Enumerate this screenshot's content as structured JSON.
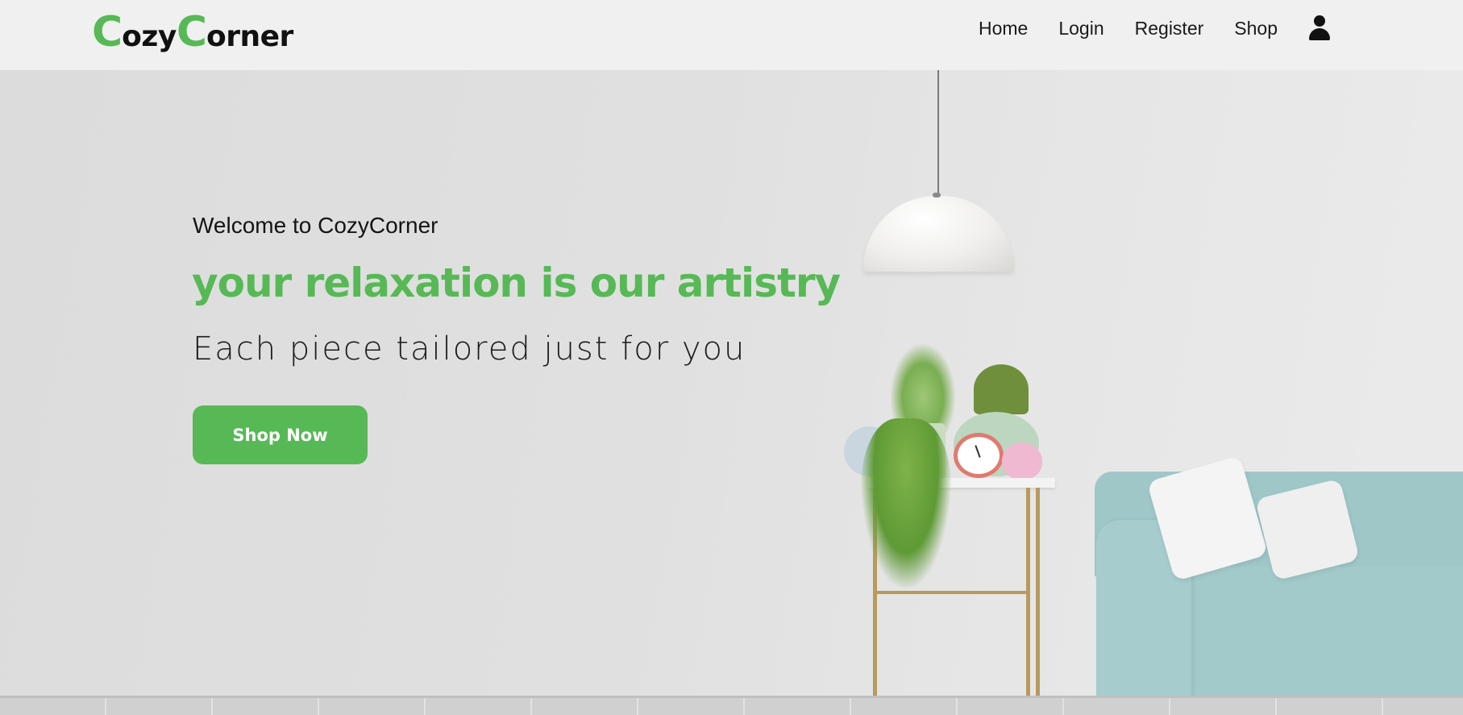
{
  "brand": {
    "first_cap": "C",
    "first_rest": "ozy",
    "second_cap": "C",
    "second_rest": "orner"
  },
  "nav": {
    "items": [
      {
        "label": "Home"
      },
      {
        "label": "Login"
      },
      {
        "label": "Register"
      },
      {
        "label": "Shop"
      }
    ],
    "user_icon": "user-icon"
  },
  "hero": {
    "welcome": "Welcome to CozyCorner",
    "headline": "your relaxation is our artistry",
    "subline": "Each piece tailored just for you",
    "cta_label": "Shop Now"
  },
  "colors": {
    "accent": "#57b955",
    "nav_bg": "#f0f0f0",
    "text": "#141414"
  }
}
